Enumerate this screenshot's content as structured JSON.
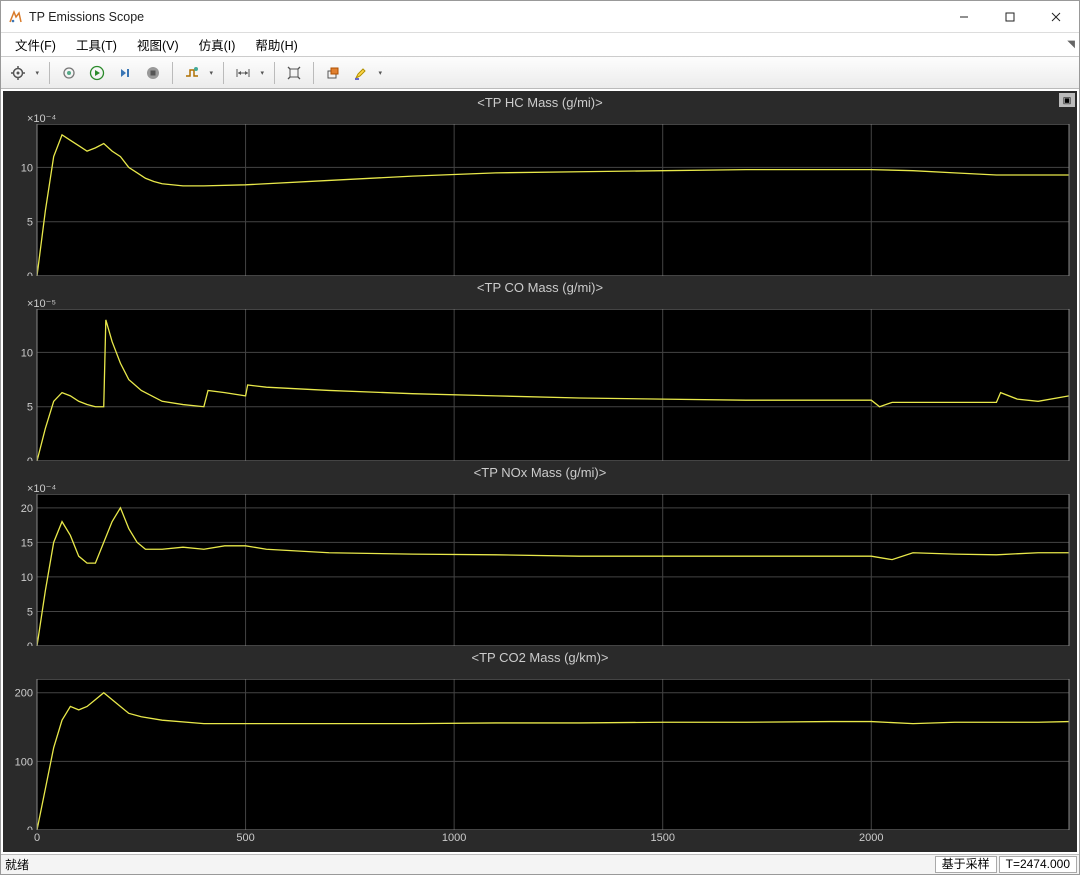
{
  "window": {
    "title": "TP Emissions Scope"
  },
  "menu": {
    "file": "文件(F)",
    "tools": "工具(T)",
    "view": "视图(V)",
    "simulation": "仿真(I)",
    "help": "帮助(H)"
  },
  "toolbar_icons": {
    "config": "gear-icon",
    "model": "cogwheel-icon",
    "run": "play-icon",
    "step": "step-forward-icon",
    "stop": "stop-icon",
    "trigger": "trigger-icon",
    "cursor": "cursor-measure-icon",
    "autoscale": "autoscale-icon",
    "float": "float-icon",
    "highlight": "highlight-icon"
  },
  "status": {
    "ready": "就绪",
    "mode": "基于采样",
    "time": "T=2474.000"
  },
  "xaxis": {
    "limits": [
      0,
      2474
    ],
    "ticks": [
      0,
      500,
      1000,
      1500,
      2000
    ]
  },
  "chart_data": [
    {
      "type": "line",
      "title": "<TP HC Mass (g/mi)>",
      "y_exponent": "×10⁻⁴",
      "ylim": [
        0,
        14
      ],
      "yticks": [
        0,
        5,
        10
      ],
      "x": [
        0,
        20,
        40,
        60,
        80,
        100,
        120,
        140,
        160,
        180,
        200,
        220,
        240,
        260,
        280,
        300,
        350,
        400,
        500,
        700,
        900,
        1100,
        1300,
        1500,
        1700,
        1900,
        2000,
        2100,
        2200,
        2300,
        2400,
        2474
      ],
      "values": [
        0,
        6,
        11,
        13,
        12.5,
        12,
        11.5,
        11.8,
        12.2,
        11.5,
        11,
        10,
        9.5,
        9,
        8.7,
        8.5,
        8.3,
        8.3,
        8.4,
        8.8,
        9.2,
        9.5,
        9.6,
        9.7,
        9.8,
        9.8,
        9.8,
        9.7,
        9.5,
        9.3,
        9.3,
        9.3
      ]
    },
    {
      "type": "line",
      "title": "<TP CO Mass (g/mi)>",
      "y_exponent": "×10⁻⁵",
      "ylim": [
        0,
        14
      ],
      "yticks": [
        0,
        5,
        10
      ],
      "x": [
        0,
        20,
        40,
        60,
        80,
        100,
        120,
        140,
        160,
        165,
        180,
        200,
        220,
        250,
        300,
        350,
        400,
        410,
        450,
        500,
        505,
        550,
        700,
        900,
        1100,
        1300,
        1500,
        1700,
        1900,
        2000,
        2020,
        2050,
        2200,
        2300,
        2310,
        2350,
        2400,
        2474
      ],
      "values": [
        0,
        3,
        5.5,
        6.3,
        6,
        5.5,
        5.2,
        5,
        5,
        13,
        11,
        9,
        7.5,
        6.5,
        5.5,
        5.2,
        5,
        6.5,
        6.3,
        6,
        7,
        6.8,
        6.5,
        6.2,
        6,
        5.8,
        5.7,
        5.6,
        5.6,
        5.6,
        5,
        5.4,
        5.4,
        5.4,
        6.3,
        5.7,
        5.5,
        6
      ],
      "notes": "spikes near x≈165, x≈410, x≈505, dip and spike near x≈2020-2310"
    },
    {
      "type": "line",
      "title": "<TP NOx Mass (g/mi)>",
      "y_exponent": "×10⁻⁴",
      "ylim": [
        0,
        22
      ],
      "yticks": [
        0,
        5,
        10,
        15,
        20
      ],
      "x": [
        0,
        20,
        40,
        60,
        80,
        100,
        120,
        140,
        160,
        180,
        200,
        220,
        240,
        260,
        300,
        350,
        400,
        450,
        500,
        550,
        700,
        900,
        1100,
        1300,
        1500,
        1700,
        1900,
        2000,
        2050,
        2100,
        2200,
        2300,
        2400,
        2474
      ],
      "values": [
        0,
        8,
        15,
        18,
        16,
        13,
        12,
        12,
        15,
        18,
        20,
        17,
        15,
        14,
        14,
        14.3,
        14,
        14.5,
        14.5,
        14,
        13.5,
        13.3,
        13.2,
        13,
        13,
        13,
        13,
        13,
        12.5,
        13.5,
        13.3,
        13.2,
        13.5,
        13.5
      ]
    },
    {
      "type": "line",
      "title": "<TP CO2 Mass (g/km)>",
      "y_exponent": "",
      "ylim": [
        0,
        220
      ],
      "yticks": [
        0,
        100,
        200
      ],
      "x": [
        0,
        20,
        40,
        60,
        80,
        100,
        120,
        140,
        160,
        180,
        200,
        220,
        250,
        300,
        400,
        500,
        700,
        900,
        1100,
        1300,
        1500,
        1700,
        1900,
        2000,
        2100,
        2200,
        2300,
        2400,
        2474
      ],
      "values": [
        0,
        60,
        120,
        160,
        180,
        175,
        180,
        190,
        200,
        190,
        180,
        170,
        165,
        160,
        155,
        155,
        155,
        155,
        156,
        156,
        157,
        157,
        158,
        158,
        155,
        157,
        157,
        157,
        158
      ]
    }
  ]
}
